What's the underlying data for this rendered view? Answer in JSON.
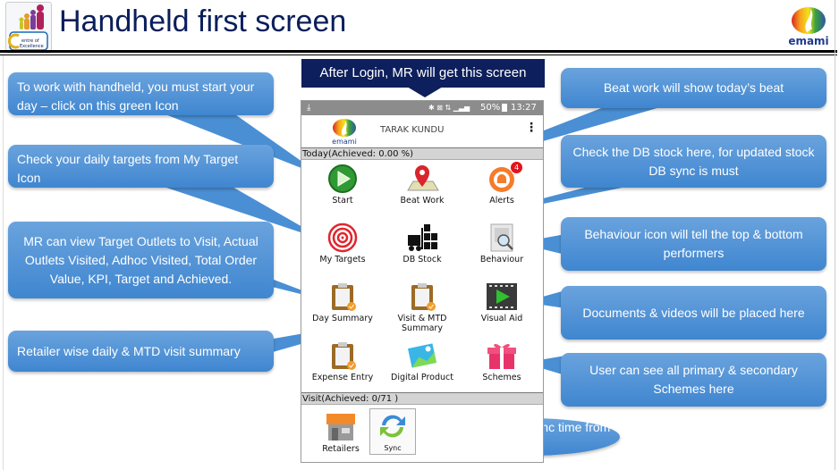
{
  "slide": {
    "title": "Handheld first screen",
    "left_logo": "Centre of Excellence",
    "right_logo": "emami",
    "banner": "After Login, MR will get this screen"
  },
  "callouts": {
    "start": "To work with handheld, you must start your day – click on this green Icon",
    "targets": "Check your daily targets from My Target Icon",
    "day_summary": "MR can view Target Outlets to Visit, Actual Outlets Visited, Adhoc Visited, Total Order Value, KPI, Target and Achieved.",
    "visit_summary": "Retailer wise daily & MTD visit summary",
    "beat": "Beat work will show today’s beat",
    "db_stock": "Check the DB stock here, for updated stock DB sync is must",
    "behaviour": "Behaviour icon will tell the top & bottom performers",
    "visual_aid": "Documents & videos will be placed here",
    "schemes": "User can see all primary & secondary Schemes here",
    "sync": "Check the last sync time from here"
  },
  "phone": {
    "status": {
      "battery": "50%",
      "time": "13:27"
    },
    "app_logo": "emami",
    "user_name": "TARAK KUNDU",
    "today_section": "Today(Achieved: 0.00 %)",
    "tiles": [
      {
        "label": "Start",
        "icon": "play-icon"
      },
      {
        "label": "Beat Work",
        "icon": "map-pin-icon"
      },
      {
        "label": "Alerts",
        "icon": "alarm-icon",
        "badge": "4"
      },
      {
        "label": "My Targets",
        "icon": "target-icon"
      },
      {
        "label": "DB Stock",
        "icon": "forklift-icon"
      },
      {
        "label": "Behaviour",
        "icon": "magnifier-icon"
      },
      {
        "label": "Day Summary",
        "icon": "clipboard-icon"
      },
      {
        "label": "Visit & MTD Summary",
        "icon": "clipboard-icon"
      },
      {
        "label": "Visual Aid",
        "icon": "video-icon"
      },
      {
        "label": "Expense Entry",
        "icon": "clipboard-icon"
      },
      {
        "label": "Digital Product",
        "icon": "photo-icon"
      },
      {
        "label": "Schemes",
        "icon": "gift-icon"
      }
    ],
    "visit_section": "Visit(Achieved: 0/71 )",
    "bottom_tiles": [
      {
        "label": "Retailers",
        "icon": "store-icon"
      },
      {
        "label": "Sync",
        "icon": "sync-icon"
      }
    ]
  },
  "colors": {
    "title": "#0b1e5b",
    "callout": "#4a8fd4",
    "banner": "#0d1f5c"
  }
}
